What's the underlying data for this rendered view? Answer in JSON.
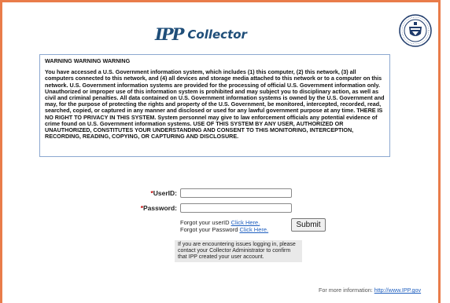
{
  "header": {
    "logo_mark": "IPP",
    "logo_text": "Collector"
  },
  "warning": {
    "title": "WARNING WARNING WARNING",
    "body": "You have accessed a U.S. Government information system, which includes (1) this computer, (2) this network, (3) all computers connected to this network, and (4) all devices and storage media attached to this network or to a computer on this network. U.S. Government information systems are provided for the processing of official U.S. Government information only. Unauthorized or improper use of this information system is prohibited and may subject you to disciplinary action, as well as civil and criminal penalties. All data contained on U.S. Government information systems is owned by the U.S. Government and may, for the purpose of protecting the rights and property of the U.S. Government, be monitored, intercepted, recorded, read, searched, copied, or captured in any manner and disclosed or used for any lawful government purpose at any time. THERE IS NO RIGHT TO PRIVACY IN THIS SYSTEM. System personnel may give to law enforcement officials any potential evidence of crime found on U.S. Government information systems. USE OF THIS SYSTEM BY ANY USER, AUTHORIZED OR UNAUTHORIZED, CONSTITUTES YOUR UNDERSTANDING AND CONSENT TO THIS MONITORING, INTERCEPTION, RECORDING, READING, COPYING, OR CAPTURING AND DISCLOSURE."
  },
  "form": {
    "required_marker": "*",
    "userid_label": "UserID:",
    "userid_value": "",
    "password_label": "Password:",
    "password_value": "",
    "forgot_userid_prefix": "Forgot your userID ",
    "forgot_userid_link": "Click Here.",
    "forgot_password_prefix": "Forgot your Password ",
    "forgot_password_link": "Click Here.",
    "submit_label": "Submit"
  },
  "notice": {
    "text": "If you are encountering issues logging in, please contact your Collector Administrator to confirm that IPP created your user account."
  },
  "footer": {
    "more_info_prefix": "For more information: ",
    "more_info_link": "http://www.IPP.gov"
  },
  "colors": {
    "frame_border": "#e97c4a",
    "brand": "#1f4e79",
    "link": "#1f5fbf",
    "required": "#c00000"
  },
  "icons": {
    "seal": "treasury-seal-icon"
  }
}
